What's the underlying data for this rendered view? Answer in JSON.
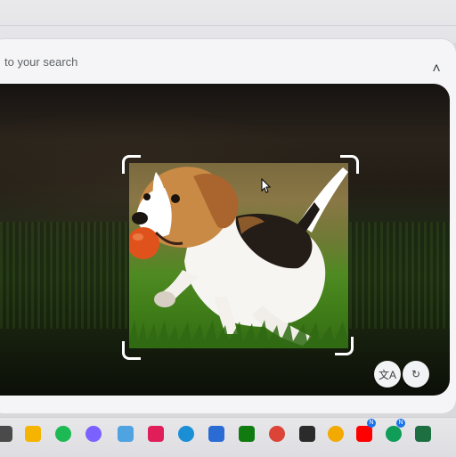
{
  "search": {
    "partial_text": "to your search"
  },
  "panel": {
    "collapse_icon": "chevron-up-icon",
    "collapse_glyph": "˄"
  },
  "viewer": {
    "image_subject": "beagle-puppy-with-orange-ball",
    "actions": [
      {
        "name": "translate-button",
        "icon": "translate-icon",
        "glyph": "文A"
      },
      {
        "name": "refresh-button",
        "icon": "refresh-icon",
        "glyph": "↻"
      }
    ]
  },
  "taskbar": {
    "apps": [
      {
        "name": "start-icon",
        "color": "#4a4a4a"
      },
      {
        "name": "file-explorer-icon",
        "color": "#f4b400"
      },
      {
        "name": "spotify-icon",
        "color": "#1db954"
      },
      {
        "name": "copilot-icon",
        "color": "#7b61ff"
      },
      {
        "name": "photos-icon",
        "color": "#4fa3e0"
      },
      {
        "name": "slack-icon",
        "color": "#e01e5a"
      },
      {
        "name": "edge-icon",
        "color": "#1a8fd6"
      },
      {
        "name": "store-icon",
        "color": "#2b6cd4"
      },
      {
        "name": "xbox-icon",
        "color": "#107c10"
      },
      {
        "name": "chrome-icon",
        "color": "#db4437"
      },
      {
        "name": "terminal-icon",
        "color": "#2b2b2b"
      },
      {
        "name": "chrome-canary-icon",
        "color": "#f2a900"
      },
      {
        "name": "youtube-music-icon",
        "color": "#ff0000",
        "badge": "N"
      },
      {
        "name": "chrome-profile-icon",
        "color": "#0f9d58",
        "badge": "N"
      },
      {
        "name": "excel-icon",
        "color": "#1d6f42"
      }
    ]
  }
}
